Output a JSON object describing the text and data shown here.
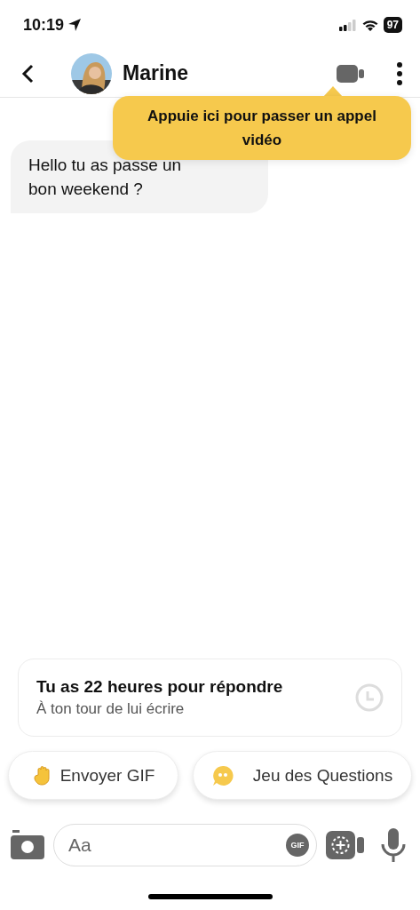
{
  "status_bar": {
    "time": "10:19",
    "battery": "97"
  },
  "header": {
    "name": "Marine"
  },
  "tooltip": {
    "text": "Appuie ici pour passer un appel vidéo"
  },
  "messages": [
    {
      "text": "Hello tu as passe un bon weekend ?"
    }
  ],
  "reply_card": {
    "title": "Tu as 22 heures pour répondre",
    "subtitle": "À ton tour de lui écrire"
  },
  "actions": [
    {
      "label": "Envoyer GIF",
      "kind": "gif"
    },
    {
      "label": "Jeu des Questions",
      "kind": "questions"
    }
  ],
  "composer": {
    "placeholder": "Aa",
    "gif_badge": "GIF"
  }
}
